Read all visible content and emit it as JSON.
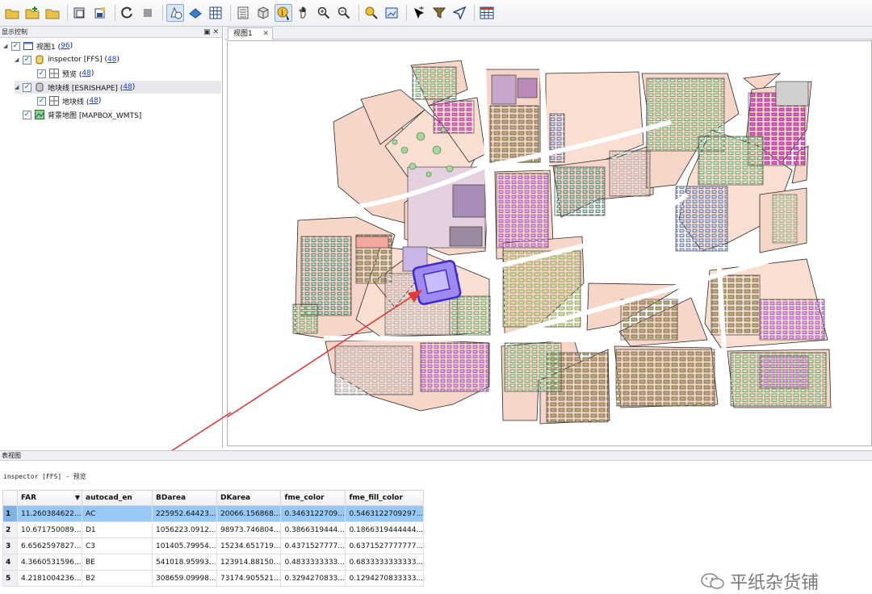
{
  "toolbar": {
    "buttons": [
      {
        "name": "open-folder-icon",
        "icon": "folder"
      },
      {
        "name": "add-layer-icon",
        "icon": "folder-add"
      },
      {
        "name": "folder-icon",
        "icon": "folder"
      },
      {
        "name": "export-icon",
        "icon": "export"
      },
      {
        "name": "save-icon",
        "icon": "save"
      },
      {
        "name": "refresh-icon",
        "icon": "refresh"
      },
      {
        "name": "stop-icon",
        "icon": "stop"
      },
      {
        "name": "shapes-icon",
        "icon": "shapes"
      },
      {
        "name": "3d-icon",
        "icon": "3d"
      },
      {
        "name": "grid-icon",
        "icon": "grid"
      },
      {
        "name": "list-icon",
        "icon": "list"
      },
      {
        "name": "cube-icon",
        "icon": "cube"
      },
      {
        "name": "identify-icon",
        "icon": "identify"
      },
      {
        "name": "pan-hand-icon",
        "icon": "hand"
      },
      {
        "name": "zoom-in-icon",
        "icon": "zoom-in"
      },
      {
        "name": "zoom-out-icon",
        "icon": "zoom-out"
      },
      {
        "name": "info-zoom-icon",
        "icon": "info"
      },
      {
        "name": "zoom-extent-icon",
        "icon": "extent"
      },
      {
        "name": "select-icon",
        "icon": "select"
      },
      {
        "name": "filter-icon",
        "icon": "filter"
      },
      {
        "name": "navigate-icon",
        "icon": "navigate"
      },
      {
        "name": "table-icon",
        "icon": "table"
      }
    ]
  },
  "left_panel": {
    "title": "显示控制",
    "controls": "▣ ✕",
    "tree": [
      {
        "label": "视图1 (",
        "count": "96",
        "suffix": ")"
      },
      {
        "label": "inspector [FFS] (",
        "count": "48",
        "suffix": ")"
      },
      {
        "label": "预览 (",
        "count": "48",
        "suffix": ")"
      },
      {
        "label": "地块线 [ESRISHAPE] (",
        "count": "48",
        "suffix": ")"
      },
      {
        "label": "地块线 (",
        "count": "48",
        "suffix": ")"
      },
      {
        "label": "背景地图 [MAPBOX_WMTS]",
        "count": "",
        "suffix": ""
      }
    ]
  },
  "map": {
    "tab_label": "视图1",
    "tab_close": "✕"
  },
  "table": {
    "section_title": "表视图",
    "layer_label": "inspector [FFS] - 预览",
    "columns": [
      "FAR",
      "autocad_en",
      "BDarea",
      "DKarea",
      "fme_color",
      "fme_fill_color"
    ],
    "sort_indicator": "▼",
    "rows": [
      {
        "n": "1",
        "cells": [
          "11.260384622...",
          "AC",
          "225952.64423...",
          "20066.156868...",
          "0.3463122709...",
          "0.5463122709297..."
        ]
      },
      {
        "n": "2",
        "cells": [
          "10.671750089...",
          "D1",
          "1056223.0912...",
          "98973.746804...",
          "0.3866319444...",
          "0.1866319444444..."
        ]
      },
      {
        "n": "3",
        "cells": [
          "6.6562597827...",
          "C3",
          "101405.79954...",
          "15234.651719...",
          "0.4371527777...",
          "0.6371527777777..."
        ]
      },
      {
        "n": "4",
        "cells": [
          "4.3660531596...",
          "BE",
          "541018.95993...",
          "123914.88150...",
          "0.4833333333...",
          "0.6833333333333..."
        ]
      },
      {
        "n": "5",
        "cells": [
          "4.2181004236...",
          "B2",
          "308659.09998...",
          "73174.905521...",
          "0.3294270833...",
          "0.1294270833333..."
        ]
      }
    ]
  },
  "watermark": {
    "text": "平纸杂货铺"
  }
}
